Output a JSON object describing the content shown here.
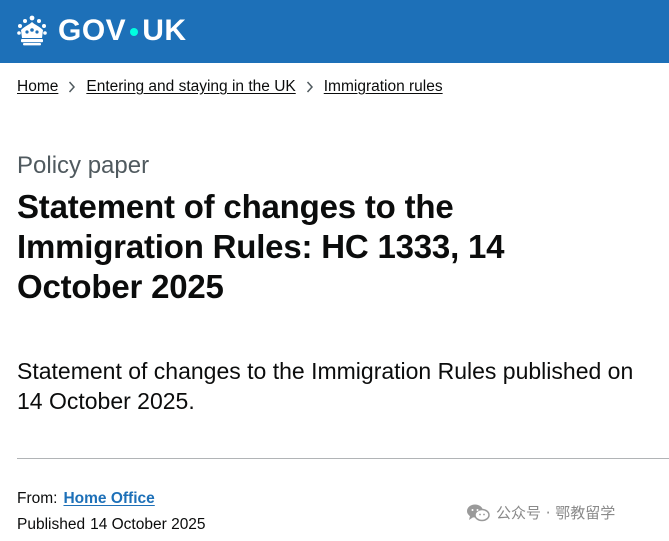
{
  "header": {
    "logo_text_left": "GOV",
    "logo_text_right": "UK",
    "logo_icon": "crown-icon",
    "brand_color": "#1d70b8",
    "dot_color": "#00ffe0"
  },
  "breadcrumbs": [
    {
      "label": "Home"
    },
    {
      "label": "Entering and staying in the UK"
    },
    {
      "label": "Immigration rules"
    }
  ],
  "main": {
    "caption": "Policy paper",
    "title": "Statement of changes to the Immigration Rules: HC 1333, 14 October 2025",
    "lead": "Statement of changes to the Immigration Rules published on 14 October 2025."
  },
  "metadata": {
    "from_label": "From:",
    "from_link": "Home Office",
    "published_label": "Published",
    "published_date": "14 October 2025",
    "link_color": "#1d70b8"
  },
  "watermark": {
    "icon": "wechat-icon",
    "text": "公众号 · 鄂教留学"
  }
}
